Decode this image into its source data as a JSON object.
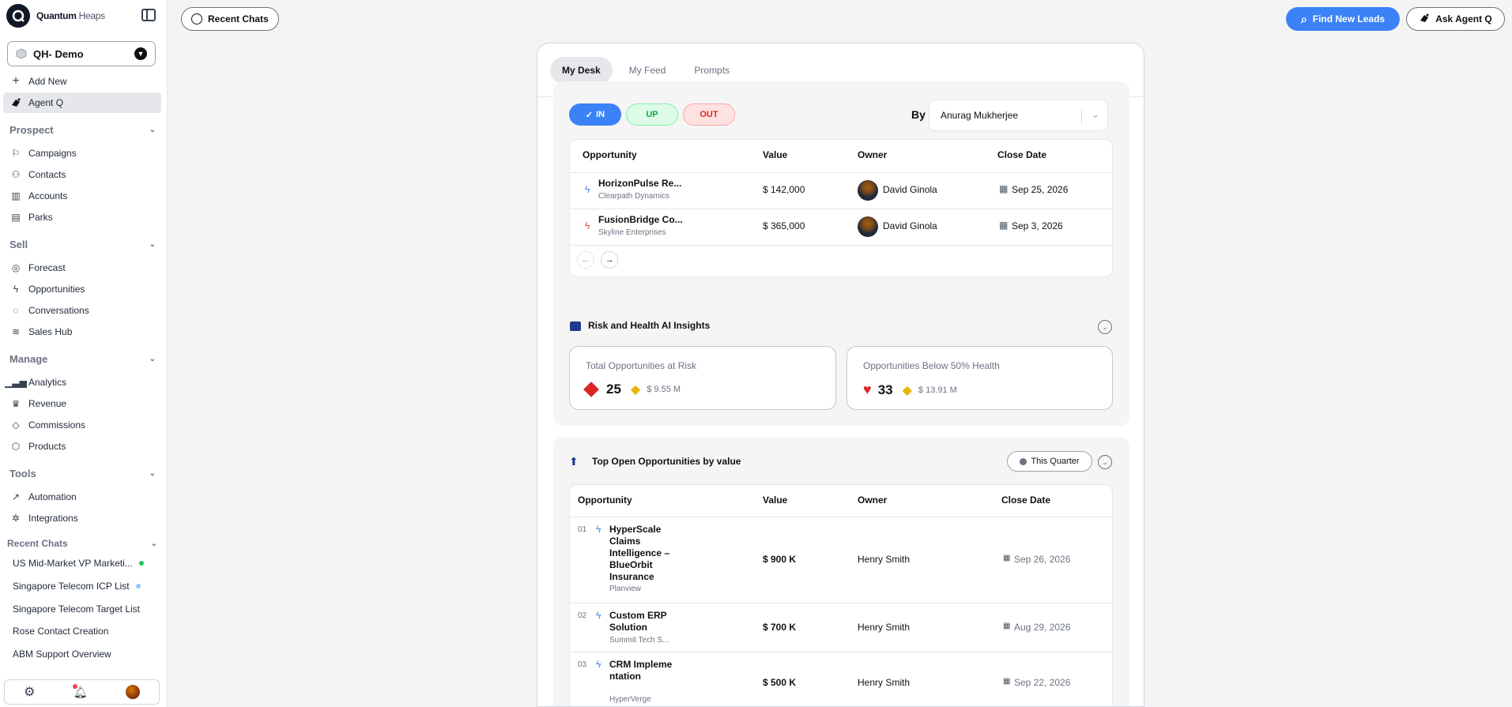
{
  "sidebar": {
    "logo_bold": "Quantum",
    "logo_light": " Heaps",
    "workspace": "QH- Demo",
    "add_new": "Add New",
    "agent_q": "Agent Q",
    "sections": {
      "prospect": "Prospect",
      "sell": "Sell",
      "manage": "Manage",
      "tools": "Tools",
      "recent": "Recent Chats"
    },
    "prospect_items": [
      "Campaigns",
      "Contacts",
      "Accounts",
      "Parks"
    ],
    "sell_items": [
      "Forecast",
      "Opportunities",
      "Conversations",
      "Sales Hub"
    ],
    "manage_items": [
      "Analytics",
      "Revenue",
      "Commissions",
      "Products"
    ],
    "tools_items": [
      "Automation",
      "Integrations"
    ],
    "recent_chats": [
      {
        "label": "US Mid-Market VP Marketi...",
        "dot": "#22c55e"
      },
      {
        "label": "Singapore Telecom ICP List",
        "dot": "#93c5fd"
      },
      {
        "label": "Singapore Telecom Target List",
        "dot": ""
      },
      {
        "label": "Rose Contact Creation",
        "dot": ""
      },
      {
        "label": "ABM Support Overview",
        "dot": ""
      }
    ]
  },
  "header": {
    "recent_chats": "Recent Chats",
    "find_leads": "Find New Leads",
    "ask_agent": "Ask Agent Q"
  },
  "tabs": [
    "My Desk",
    "My Feed",
    "Prompts"
  ],
  "forecast_card": {
    "filters": [
      "IN",
      "UP",
      "OUT"
    ],
    "by_label": "By",
    "owner_select": "Anurag Mukherjee",
    "columns": [
      "Opportunity",
      "Value",
      "Owner",
      "Close Date"
    ],
    "rows": [
      {
        "name": "HorizonPulse Re...",
        "company": "Clearpath Dynamics",
        "value": "$ 142,000",
        "owner": "David Ginola",
        "date": "Sep 25, 2026",
        "icon_color": "#3b82f6"
      },
      {
        "name": "FusionBridge Co...",
        "company": "Skyline Enterprises",
        "value": "$ 365,000",
        "owner": "David Ginola",
        "date": "Sep 3, 2026",
        "icon_color": "#ef4444"
      }
    ]
  },
  "risk_card": {
    "title": "Risk and Health AI Insights",
    "box1_title": "Total Opportunities at Risk",
    "box1_count": "25",
    "box1_value": "$ 9.55 M",
    "box2_title": "Opportunities Below 50% Health",
    "box2_count": "33",
    "box2_value": "$ 13.91 M"
  },
  "top_card": {
    "title": "Top Open Opportunities by value",
    "period": "This Quarter",
    "columns": [
      "Opportunity",
      "Value",
      "Owner",
      "Close Date"
    ],
    "rows": [
      {
        "rank": "01",
        "name": "HyperScale Claims Intelligence – BlueOrbit Insurance",
        "company": "Planview",
        "value": "$ 900 K",
        "owner": "Henry Smith",
        "date": "Sep 26, 2026"
      },
      {
        "rank": "02",
        "name": "Custom ERP Solution",
        "company": "Summit Tech S...",
        "value": "$ 700 K",
        "owner": "Henry Smith",
        "date": "Aug 29, 2026"
      },
      {
        "rank": "03",
        "name": "CRM Implementation",
        "company": "HyperVerge",
        "value": "$ 500 K",
        "owner": "Henry Smith",
        "date": "Sep 22, 2026"
      }
    ]
  }
}
